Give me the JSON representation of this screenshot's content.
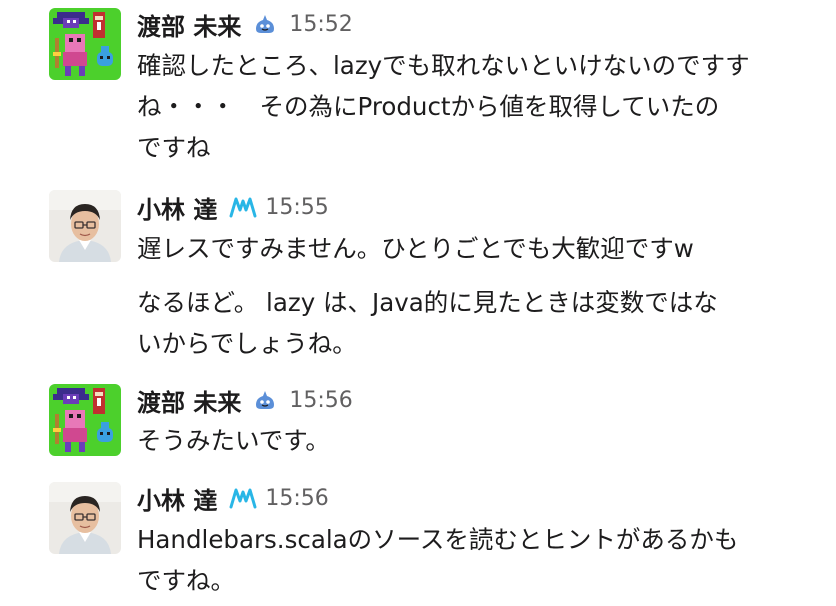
{
  "messages": [
    {
      "author": "渡部 未来",
      "time": "15:52",
      "avatar": "pixel-game-avatar",
      "badge": "slime-icon",
      "lines": [
        "確認したところ、lazyでも取れないといけないのですす",
        "ね・・・　その為にProductから値を取得していたの",
        "ですね"
      ]
    },
    {
      "author": "小林 達",
      "time": "15:55",
      "avatar": "photo-avatar",
      "badge": "m-logo-icon",
      "lines": [
        "遅レスですみません。ひとりごとでも大歓迎ですw"
      ],
      "followup_lines": [
        "なるほど。 lazy は、Java的に見たときは変数ではな",
        "いからでしょうね。"
      ]
    },
    {
      "author": "渡部 未来",
      "time": "15:56",
      "avatar": "pixel-game-avatar",
      "badge": "slime-icon",
      "lines": [
        "そうみたいです。"
      ]
    },
    {
      "author": "小林 達",
      "time": "15:56",
      "avatar": "photo-avatar",
      "badge": "m-logo-icon",
      "lines": [
        "Handlebars.scalaのソースを読むとヒントがあるかも",
        "ですね。"
      ]
    }
  ]
}
